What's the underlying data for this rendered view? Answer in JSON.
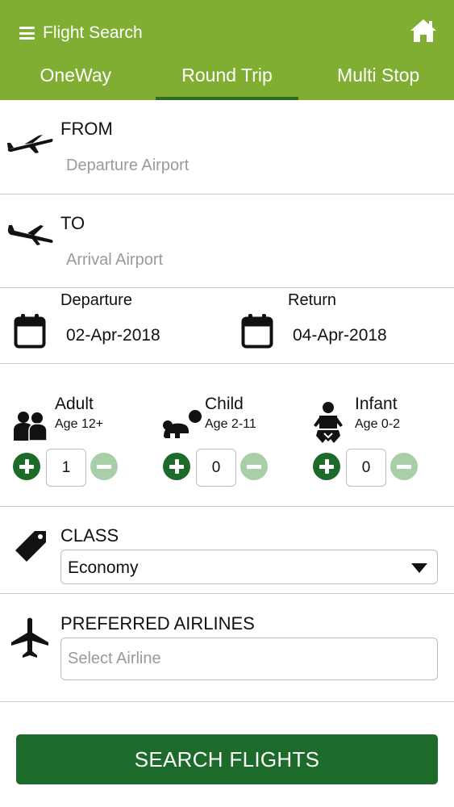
{
  "header": {
    "title": "Flight Search",
    "menu_icon": "hamburger-menu-icon",
    "home_icon": "home-icon",
    "bg_color": "#7fae33"
  },
  "tabs": [
    {
      "label": "OneWay",
      "active": false
    },
    {
      "label": "Round Trip",
      "active": true
    },
    {
      "label": "Multi Stop",
      "active": false
    }
  ],
  "from": {
    "label": "FROM",
    "placeholder": "Departure Airport",
    "icon": "plane-takeoff-icon"
  },
  "to": {
    "label": "TO",
    "placeholder": "Arrival Airport",
    "icon": "plane-landing-icon"
  },
  "dates": {
    "departure": {
      "label": "Departure",
      "value": "02-Apr-2018",
      "icon": "calendar-icon"
    },
    "return": {
      "label": "Return",
      "value": "04-Apr-2018",
      "icon": "calendar-icon"
    }
  },
  "passengers": {
    "adult": {
      "label": "Adult",
      "age": "Age 12+",
      "count": "1",
      "icon": "adult-people-icon"
    },
    "child": {
      "label": "Child",
      "age": "Age 2-11",
      "count": "0",
      "icon": "child-crawling-icon"
    },
    "infant": {
      "label": "Infant",
      "age": "Age 0-2",
      "count": "0",
      "icon": "infant-baby-icon"
    }
  },
  "travel_class": {
    "label": "CLASS",
    "selected": "Economy",
    "icon": "tag-icon"
  },
  "airlines": {
    "label": "PREFERRED AIRLINES",
    "placeholder": "Select Airline",
    "icon": "airplane-icon"
  },
  "search_button": {
    "label": "SEARCH FLIGHTS",
    "color": "#1d6b2a"
  }
}
